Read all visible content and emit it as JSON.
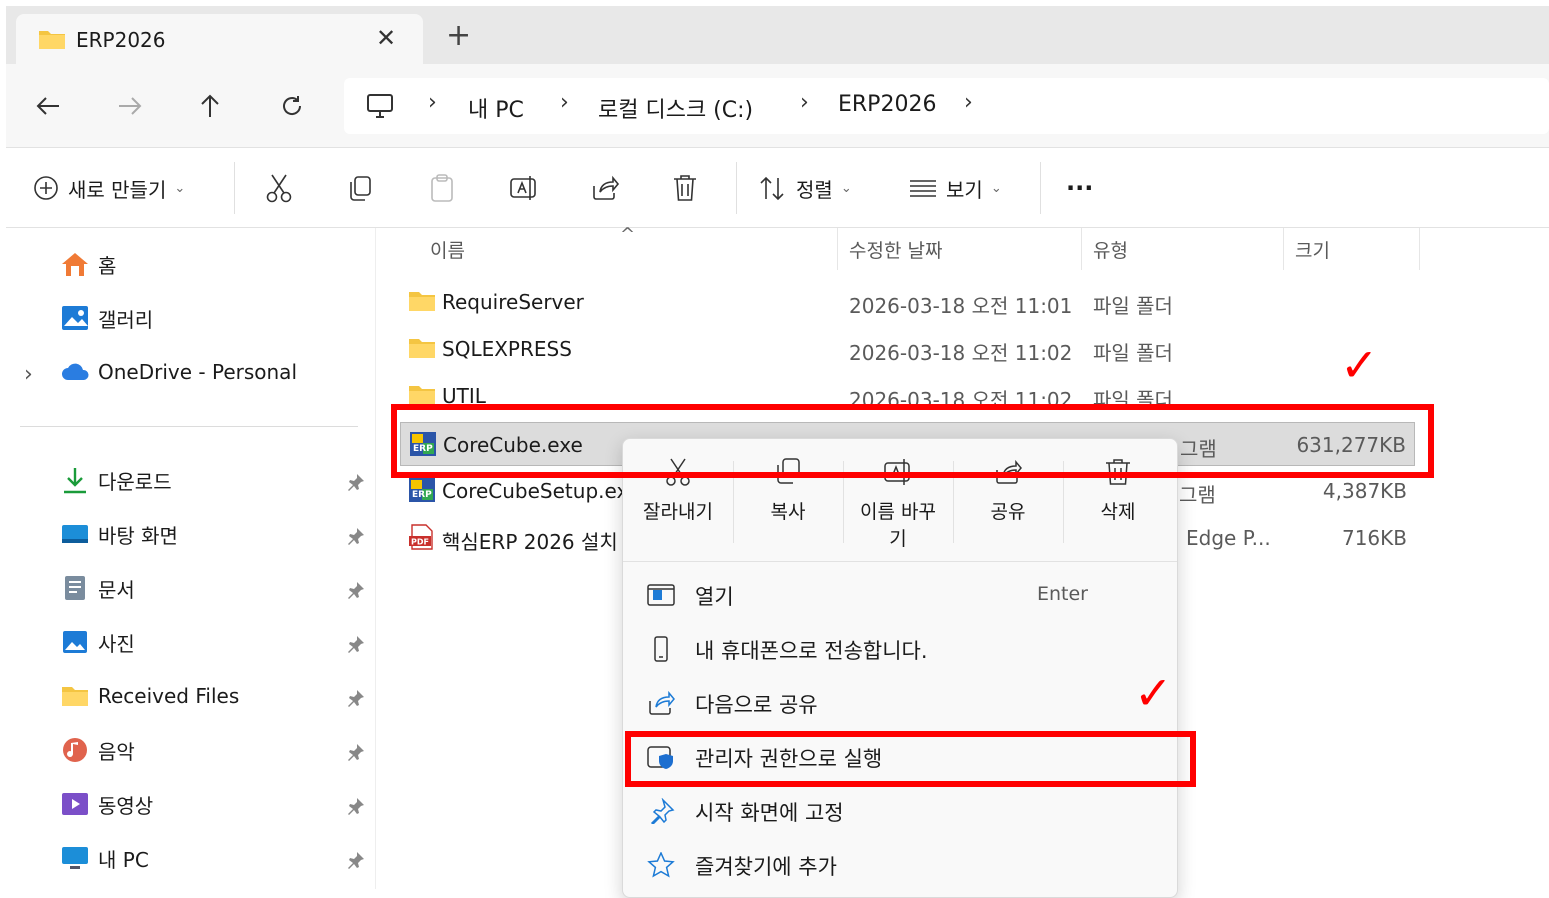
{
  "tab": {
    "title": "ERP2026",
    "close": "✕",
    "new": "+"
  },
  "nav": {
    "back": "←",
    "forward": "→",
    "up": "↑",
    "refresh": "↻",
    "breadcrumbs": [
      "내 PC",
      "로컬 디스크 (C:)",
      "ERP2026"
    ],
    "separator": "›"
  },
  "toolbar": {
    "new_label": "새로 만들기",
    "sort_label": "정렬",
    "view_label": "보기",
    "more": "···",
    "chevron": "⌄"
  },
  "sidebar": {
    "top": [
      {
        "label": "홈",
        "icon": "home-icon"
      },
      {
        "label": "갤러리",
        "icon": "gallery-icon"
      },
      {
        "label": "OneDrive - Personal",
        "icon": "onedrive-icon",
        "expander": "›"
      }
    ],
    "pinned": [
      {
        "label": "다운로드",
        "icon": "download-icon"
      },
      {
        "label": "바탕 화면",
        "icon": "desktop-icon"
      },
      {
        "label": "문서",
        "icon": "document-icon"
      },
      {
        "label": "사진",
        "icon": "pictures-icon"
      },
      {
        "label": "Received Files",
        "icon": "folder-icon"
      },
      {
        "label": "음악",
        "icon": "music-icon"
      },
      {
        "label": "동영상",
        "icon": "video-icon"
      },
      {
        "label": "내 PC",
        "icon": "pc-icon"
      }
    ]
  },
  "columns": {
    "name": "이름",
    "date": "수정한 날짜",
    "type": "유형",
    "size": "크기",
    "sort_indicator": "^"
  },
  "files": [
    {
      "name": "RequireServer",
      "date": "2026-03-18 오전 11:01",
      "type": "파일 폴더",
      "size": "",
      "icon": "folder-icon"
    },
    {
      "name": "SQLEXPRESS",
      "date": "2026-03-18 오전 11:02",
      "type": "파일 폴더",
      "size": "",
      "icon": "folder-icon"
    },
    {
      "name": "UTIL",
      "date": "2026-03-18 오전 11:02",
      "type": "파일 폴더",
      "size": "",
      "icon": "folder-icon"
    },
    {
      "name": "CoreCube.exe",
      "date": "",
      "type": "그램",
      "size": "631,277KB",
      "icon": "erp-app-icon",
      "selected": true
    },
    {
      "name": "CoreCubeSetup.exe",
      "date": "",
      "type": "그램",
      "size": "4,387KB",
      "icon": "erp-app-icon"
    },
    {
      "name": "핵심ERP 2026 설치",
      "date": "",
      "type": "Edge P...",
      "size": "716KB",
      "icon": "pdf-icon"
    }
  ],
  "context_menu": {
    "quick_actions": [
      {
        "label": "잘라내기",
        "icon": "cut-icon"
      },
      {
        "label": "복사",
        "icon": "copy-icon"
      },
      {
        "label": "이름 바꾸\n기",
        "icon": "rename-icon"
      },
      {
        "label": "공유",
        "icon": "share-icon"
      },
      {
        "label": "삭제",
        "icon": "delete-icon"
      }
    ],
    "items": [
      {
        "label": "열기",
        "shortcut": "Enter",
        "icon": "open-icon"
      },
      {
        "label": "내 휴대폰으로 전송합니다.",
        "shortcut": "",
        "icon": "phone-icon"
      },
      {
        "label": "다음으로 공유",
        "shortcut": "",
        "icon": "share-icon"
      },
      {
        "label": "관리자 권한으로 실행",
        "shortcut": "",
        "icon": "shield-icon"
      },
      {
        "label": "시작 화면에 고정",
        "shortcut": "",
        "icon": "pin-icon"
      },
      {
        "label": "즐겨찾기에 추가",
        "shortcut": "",
        "icon": "star-icon"
      }
    ]
  },
  "annotations": {
    "check": "✓",
    "highlight_color": "#ff0000"
  },
  "colors": {
    "folder": "#f4c542",
    "accent": "#0067c0",
    "selected_row": "#dcdcdc"
  }
}
